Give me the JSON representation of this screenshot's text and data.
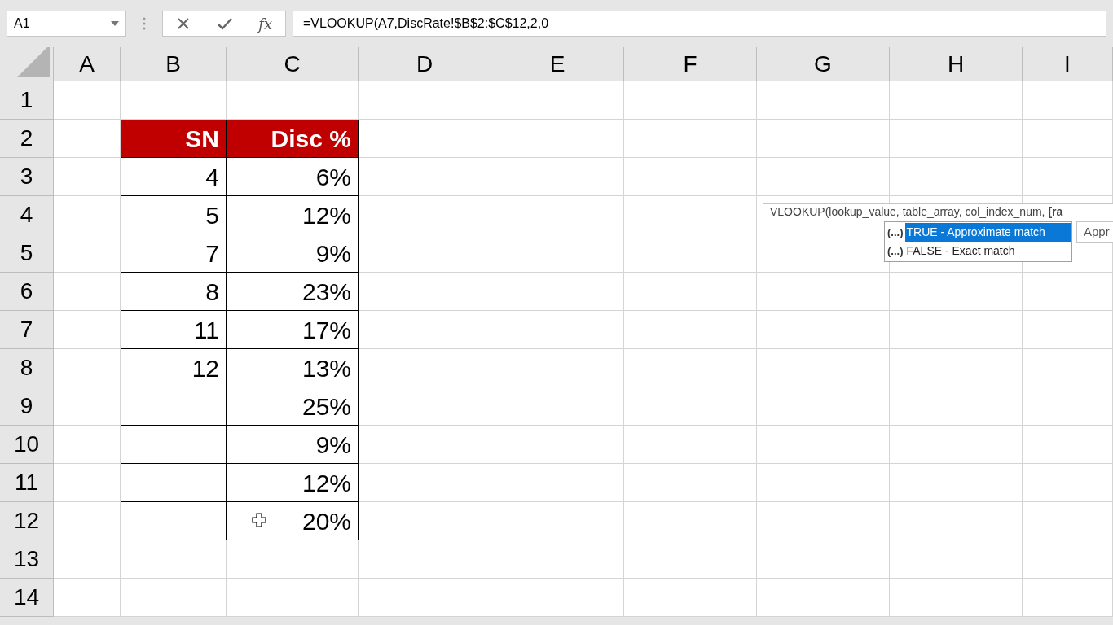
{
  "name_box": "A1",
  "formula_bar": {
    "function_label": "fx",
    "formula": "=VLOOKUP(A7,DiscRate!$B$2:$C$12,2,0"
  },
  "columns": [
    "A",
    "B",
    "C",
    "D",
    "E",
    "F",
    "G",
    "H",
    "I"
  ],
  "rows": [
    "1",
    "2",
    "3",
    "4",
    "5",
    "6",
    "7",
    "8",
    "9",
    "10",
    "11",
    "12",
    "13",
    "14"
  ],
  "table": {
    "columns": [
      "SN",
      "Disc %"
    ],
    "rows": [
      {
        "sn": "4",
        "disc": "6%"
      },
      {
        "sn": "5",
        "disc": "12%"
      },
      {
        "sn": "7",
        "disc": "9%"
      },
      {
        "sn": "8",
        "disc": "23%"
      },
      {
        "sn": "11",
        "disc": "17%"
      },
      {
        "sn": "12",
        "disc": "13%"
      },
      {
        "disc": "25%"
      },
      {
        "disc": "9%"
      },
      {
        "disc": "12%"
      },
      {
        "disc": "20%"
      }
    ]
  },
  "tooltip": {
    "signature": "VLOOKUP(lookup_value, table_array, col_index_num, **[ra**",
    "options": [
      {
        "icon": "(...)",
        "label": "TRUE - Approximate match",
        "selected": true
      },
      {
        "icon": "(...)",
        "label": "FALSE - Exact match",
        "selected": false
      }
    ],
    "description": "Appr"
  }
}
